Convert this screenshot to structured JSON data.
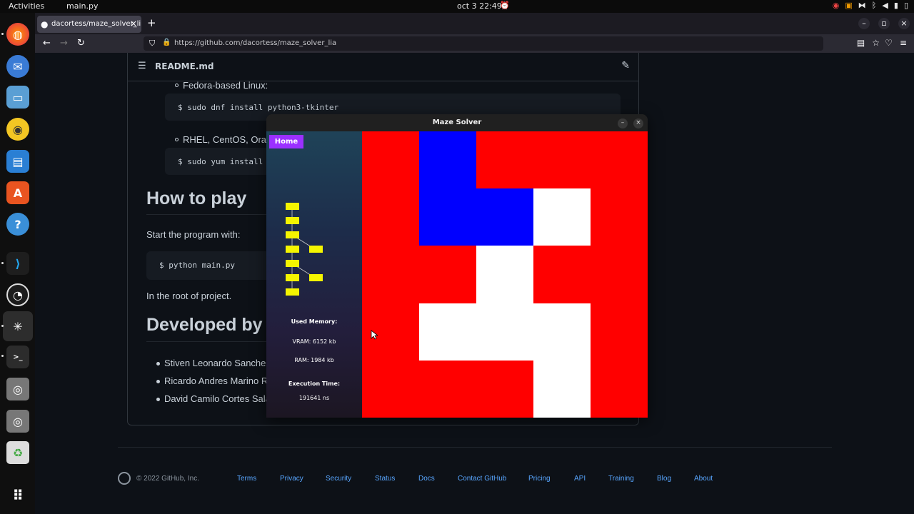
{
  "topbar": {
    "activities": "Activities",
    "app_name": "main.py",
    "clock": "oct 3  22:49"
  },
  "dock": {
    "items": [
      "firefox-icon",
      "thunderbird-icon",
      "files-icon",
      "rhythmbox-icon",
      "writer-icon",
      "app-center-icon",
      "help-icon",
      "vscode-icon",
      "obs-icon",
      "graph-app-icon",
      "terminal-icon",
      "disk-icon",
      "disk-icon",
      "trash-icon",
      "app-grid-icon"
    ]
  },
  "browser": {
    "tab_title": "dacortess/maze_solver_li",
    "url_host": "https://github.com",
    "url_path": "/dacortess/maze_solver_lia"
  },
  "readme": {
    "filename": "README.md",
    "fedora_label": "Fedora-based Linux:",
    "fedora_cmd": "$ sudo dnf install python3-tkinter",
    "rhel_label": "RHEL, CentOS, Orac",
    "rhel_cmd": "$ sudo yum install",
    "how_to_play": "How to play",
    "start_text": "Start the program with:",
    "run_cmd": "$ python main.py",
    "root_text": "In the root of project.",
    "developed_by": "Developed by",
    "developers": [
      "Stiven Leonardo Sanchez",
      "Ricardo Andres Marino R",
      "David Camilo Cortes Sala"
    ]
  },
  "footer": {
    "copyright": "© 2022 GitHub, Inc.",
    "links": [
      "Terms",
      "Privacy",
      "Security",
      "Status",
      "Docs",
      "Contact GitHub",
      "Pricing",
      "API",
      "Training",
      "Blog",
      "About"
    ]
  },
  "app": {
    "title": "Maze Solver",
    "home_button": "Home",
    "used_memory_label": "Used Memory:",
    "vram": "VRAM: 6152 kb",
    "ram": "RAM: 1984 kb",
    "execution_time_label": "Execution Time:",
    "execution_time": "191641 ns",
    "colors": {
      "wall": "#ff0000",
      "path": "#0000ff",
      "open": "#ffffff",
      "home": "#9b30ff",
      "node": "#f5f500"
    },
    "maze_grid": {
      "rows": 5,
      "cols": 5,
      "cells": [
        [
          "wall",
          "path",
          "wall",
          "wall",
          "wall"
        ],
        [
          "wall",
          "path",
          "path",
          "open",
          "wall"
        ],
        [
          "wall",
          "wall",
          "open",
          "wall",
          "wall"
        ],
        [
          "wall",
          "open",
          "open",
          "open",
          "wall"
        ],
        [
          "wall",
          "wall",
          "wall",
          "open",
          "wall"
        ]
      ]
    }
  }
}
